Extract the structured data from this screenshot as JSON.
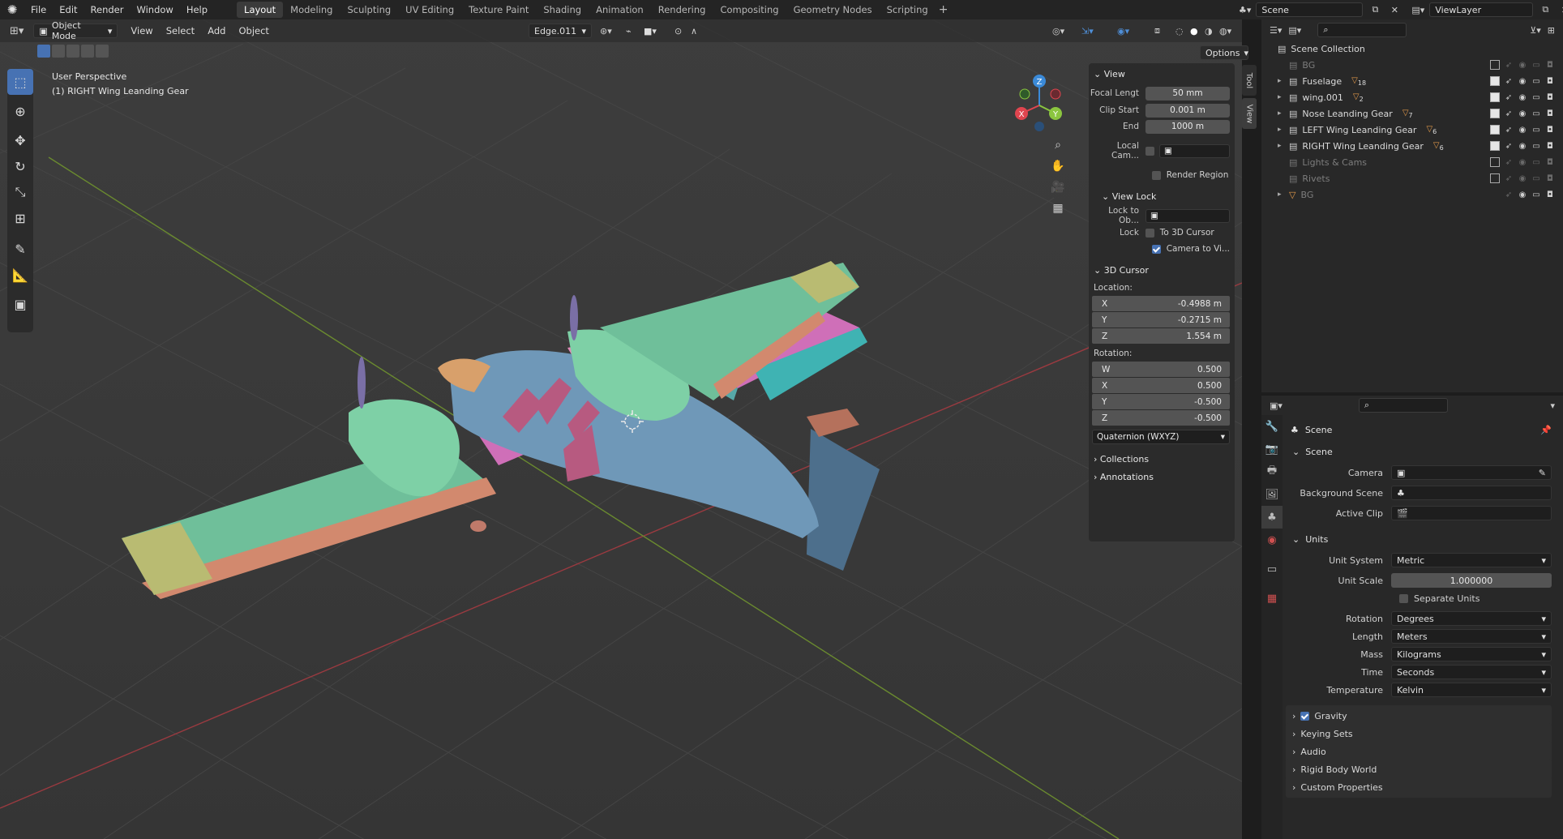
{
  "topbar": {
    "menus": [
      "File",
      "Edit",
      "Render",
      "Window",
      "Help"
    ],
    "workspaces": [
      "Layout",
      "Modeling",
      "Sculpting",
      "UV Editing",
      "Texture Paint",
      "Shading",
      "Animation",
      "Rendering",
      "Compositing",
      "Geometry Nodes",
      "Scripting"
    ],
    "active_workspace": "Layout",
    "scene_name": "Scene",
    "view_layer": "ViewLayer"
  },
  "viewport_header": {
    "mode": "Object Mode",
    "menus": [
      "View",
      "Select",
      "Add",
      "Object"
    ],
    "edge_field": "Edge.011",
    "options_label": "Options"
  },
  "viewport": {
    "perspective": "User Perspective",
    "active_object": "(1) RIGHT Wing Leanding Gear"
  },
  "npanel": {
    "view_title": "View",
    "focal_label": "Focal Lengt",
    "focal_value": "50 mm",
    "clip_start_label": "Clip Start",
    "clip_start_value": "0.001 m",
    "end_label": "End",
    "end_value": "1000 m",
    "local_cam_label": "Local Cam...",
    "render_region_label": "Render Region",
    "view_lock_title": "View Lock",
    "lock_to_ob_label": "Lock to Ob...",
    "lock_label": "Lock",
    "to_3d_cursor": "To 3D Cursor",
    "camera_to_view": "Camera to Vi...",
    "cursor_title": "3D Cursor",
    "location_label": "Location:",
    "loc_x": "-0.4988 m",
    "loc_y": "-0.2715 m",
    "loc_z": "1.554 m",
    "rotation_label": "Rotation:",
    "rot_w": "0.500",
    "rot_x": "0.500",
    "rot_y": "-0.500",
    "rot_z": "-0.500",
    "rotation_mode": "Quaternion (WXYZ)",
    "collections": "Collections",
    "annotations": "Annotations",
    "tabs": [
      "Tool",
      "View"
    ]
  },
  "outliner": {
    "root": "Scene Collection",
    "items": [
      {
        "name": "BG",
        "dim": true,
        "badge": ""
      },
      {
        "name": "Fuselage",
        "dim": false,
        "badge": "18"
      },
      {
        "name": "wing.001",
        "dim": false,
        "badge": "2"
      },
      {
        "name": "Nose Leanding Gear",
        "dim": false,
        "badge": "7"
      },
      {
        "name": "LEFT Wing Leanding Gear",
        "dim": false,
        "badge": "6"
      },
      {
        "name": "RIGHT Wing Leanding Gear",
        "dim": false,
        "badge": "6"
      },
      {
        "name": "Lights & Cams",
        "dim": true,
        "badge": ""
      },
      {
        "name": "Rivets",
        "dim": true,
        "badge": ""
      },
      {
        "name": "BG",
        "dim": true,
        "badge": ""
      }
    ]
  },
  "properties": {
    "title": "Scene",
    "scene_section": "Scene",
    "camera_label": "Camera",
    "background_scene_label": "Background Scene",
    "active_clip_label": "Active Clip",
    "units_section": "Units",
    "unit_system_label": "Unit System",
    "unit_system": "Metric",
    "unit_scale_label": "Unit Scale",
    "unit_scale": "1.000000",
    "separate_units": "Separate Units",
    "rotation_label": "Rotation",
    "rotation": "Degrees",
    "length_label": "Length",
    "length": "Meters",
    "mass_label": "Mass",
    "mass": "Kilograms",
    "time_label": "Time",
    "time": "Seconds",
    "temperature_label": "Temperature",
    "temperature": "Kelvin",
    "collapsed": [
      "Gravity",
      "Keying Sets",
      "Audio",
      "Rigid Body World",
      "Custom Properties"
    ]
  },
  "colors": {
    "accent": "#4772b3",
    "axis_x": "#e0454f",
    "axis_y": "#8bc53f",
    "axis_z": "#3b8ad8"
  }
}
